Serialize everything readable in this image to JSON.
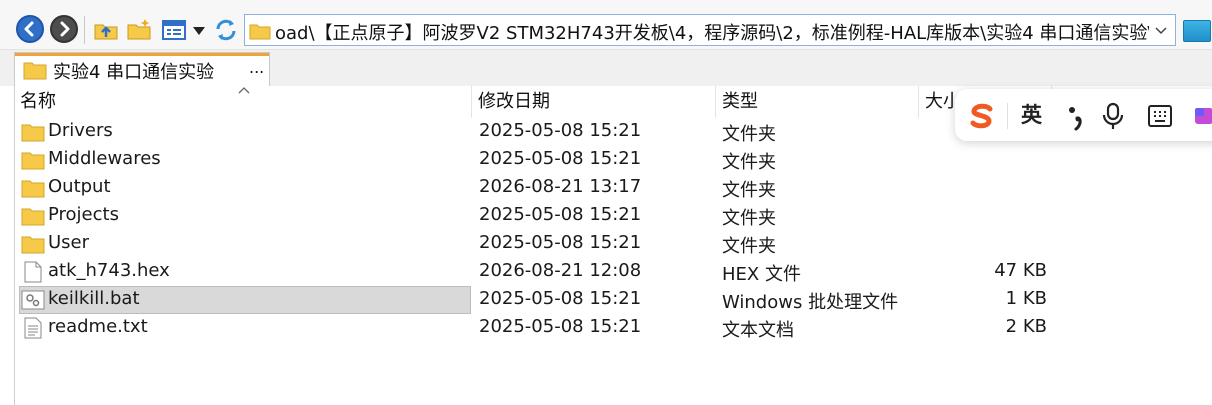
{
  "address": {
    "path": "oad\\【正点原子】阿波罗V2 STM32H743开发板\\4，程序源码\\2，标准例程-HAL库版本\\实验4 串口通信实验\\"
  },
  "tab": {
    "label": "实验4 串口通信实验",
    "more": "..."
  },
  "columns": {
    "name": "名称",
    "date": "修改日期",
    "type": "类型",
    "size": "大小"
  },
  "files": [
    {
      "name": "Drivers",
      "date": "2025-05-08 15:21",
      "type": "文件夹",
      "size": "",
      "icon": "folder-icon"
    },
    {
      "name": "Middlewares",
      "date": "2025-05-08 15:21",
      "type": "文件夹",
      "size": "",
      "icon": "folder-icon"
    },
    {
      "name": "Output",
      "date": "2026-08-21 13:17",
      "type": "文件夹",
      "size": "",
      "icon": "folder-icon"
    },
    {
      "name": "Projects",
      "date": "2025-05-08 15:21",
      "type": "文件夹",
      "size": "",
      "icon": "folder-icon"
    },
    {
      "name": "User",
      "date": "2025-05-08 15:21",
      "type": "文件夹",
      "size": "",
      "icon": "folder-icon"
    },
    {
      "name": "atk_h743.hex",
      "date": "2026-08-21 12:08",
      "type": "HEX 文件",
      "size": "47 KB",
      "icon": "document-icon"
    },
    {
      "name": "keilkill.bat",
      "date": "2025-05-08 15:21",
      "type": "Windows 批处理文件",
      "size": "1 KB",
      "icon": "batch-file-icon",
      "selected": true
    },
    {
      "name": "readme.txt",
      "date": "2025-05-08 15:21",
      "type": "文本文档",
      "size": "2 KB",
      "icon": "text-file-icon"
    }
  ],
  "ime": {
    "mode": "英"
  },
  "colors": {
    "folder": "#f7c948",
    "selection": "#d9d9d9",
    "ime_logo": "#f05a23",
    "tab_accent": "#f0a33a"
  }
}
